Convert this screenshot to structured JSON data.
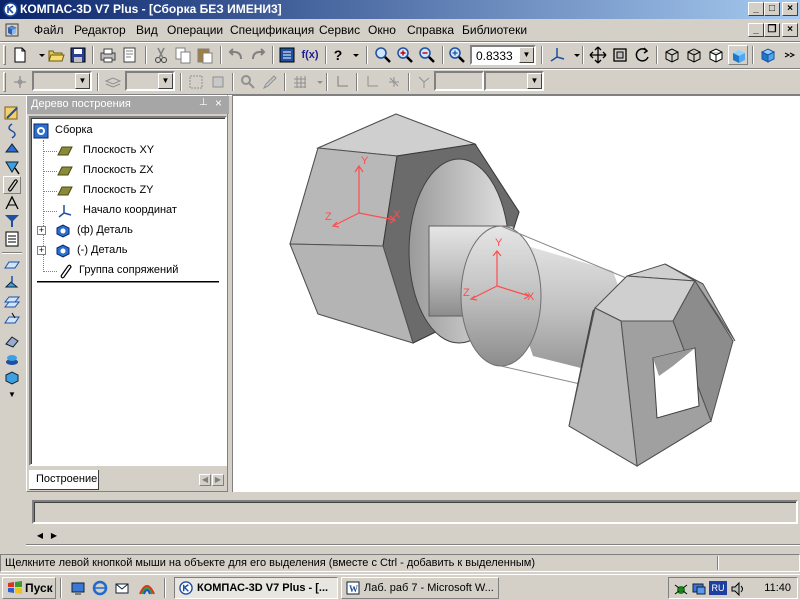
{
  "window": {
    "title": "КОМПАС-3D V7 Plus - [Сборка БЕЗ ИМЕНИ3]",
    "minimize": "_",
    "maximize": "□",
    "close": "×"
  },
  "doc_controls": {
    "minimize": "_",
    "restore": "❐",
    "close": "×"
  },
  "menu": [
    {
      "label": "Файл"
    },
    {
      "label": "Редактор"
    },
    {
      "label": "Вид"
    },
    {
      "label": "Операции"
    },
    {
      "label": "Спецификация"
    },
    {
      "label": "Сервис"
    },
    {
      "label": "Окно"
    },
    {
      "label": "Справка"
    },
    {
      "label": "Библиотеки"
    }
  ],
  "toolbar": {
    "zoom_value": "0.8333",
    "fx_label": "f(x)",
    "help_label": "?"
  },
  "tree": {
    "header": "Дерево построения",
    "pin": "⊥",
    "close": "×",
    "items": [
      {
        "label": "Сборка",
        "icon": "assembly-icon"
      },
      {
        "label": "Плоскость XY",
        "icon": "plane-icon"
      },
      {
        "label": "Плоскость ZX",
        "icon": "plane-icon"
      },
      {
        "label": "Плоскость ZY",
        "icon": "plane-icon"
      },
      {
        "label": "Начало координат",
        "icon": "origin-icon"
      },
      {
        "label": "(ф) Деталь",
        "icon": "part-icon",
        "expander": "+"
      },
      {
        "label": "(-) Деталь",
        "icon": "part-icon",
        "expander": "+"
      },
      {
        "label": "Группа сопряжений",
        "icon": "mate-group-icon"
      }
    ],
    "tab_label": "Построение"
  },
  "viewport": {
    "axis_labels": {
      "x": "X",
      "y": "Y",
      "z": "Z"
    },
    "colors": {
      "axis": "#ff4d4d",
      "body_light": "#c8c8c8",
      "body_dark": "#707070"
    }
  },
  "status_text": "Щелкните левой кнопкой мыши на объекте для его выделения (вместе с Ctrl - добавить к выделенным)",
  "taskbar": {
    "start_label": "Пуск",
    "tasks": [
      {
        "label": "КОМПАС-3D V7 Plus - [...",
        "active": true
      },
      {
        "label": "Лаб. раб  7 - Microsoft W...",
        "active": false
      }
    ],
    "lang": "RU",
    "clock": "11:40"
  }
}
